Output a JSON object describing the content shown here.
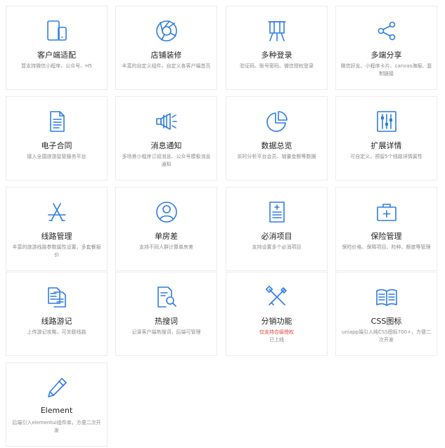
{
  "cards": [
    {
      "title": "客户端适配",
      "desc": "暂支持微信小程序、公众号、H5",
      "icon": "devices-icon"
    },
    {
      "title": "店铺装修",
      "desc": "丰富的自定义组件，自定义各客户端首页",
      "icon": "aperture-icon"
    },
    {
      "title": "多种登录",
      "desc": "验证码、账号密码、微信授权登录",
      "icon": "easel-icon"
    },
    {
      "title": "多端分享",
      "desc": "微信好友、小程序卡片、canvas海报、复制链接",
      "icon": "share-icon"
    },
    {
      "title": "电子合同",
      "desc": "接入全国旅游监管服务平台",
      "icon": "document-icon"
    },
    {
      "title": "消息通知",
      "desc": "多场景小程序订阅消息、公众号模板消息通知",
      "icon": "megaphone-icon"
    },
    {
      "title": "数据总览",
      "desc": "实时分析平台会员、销量金额等数据",
      "icon": "pie-chart-icon"
    },
    {
      "title": "扩展详情",
      "desc": "可自定义，预留5个线路详情属性",
      "icon": "sliders-icon"
    },
    {
      "title": "线路管理",
      "desc": "丰富的旅游线路参数属性设置，多套餐报价",
      "icon": "app-store-icon"
    },
    {
      "title": "单房差",
      "desc": "支持不同人群计算单房差",
      "icon": "user-icon"
    },
    {
      "title": "必消项目",
      "desc": "支持设置多个必消项目",
      "icon": "form-icon"
    },
    {
      "title": "保险管理",
      "desc": "保险价格、保障项目、险种、额度等管理",
      "icon": "medical-kit-icon"
    },
    {
      "title": "线路游记",
      "desc": "上传游记攻略，可关联线路",
      "icon": "files-icon"
    },
    {
      "title": "热搜词",
      "desc": "记录客户端热搜词，后端可管理",
      "icon": "doc-search-icon"
    },
    {
      "title": "分销功能",
      "desc": "仅支持合级授权",
      "desc2": "已上线",
      "icon": "tools-icon",
      "red": true
    },
    {
      "title": "CSS图标",
      "desc": "uniapp端引入纯CSS图标700+，方便二次开发",
      "icon": "book-icon"
    },
    {
      "title": "Element",
      "desc": "后端引入elementui组件库，方便二次开发",
      "icon": "pen-icon"
    }
  ]
}
